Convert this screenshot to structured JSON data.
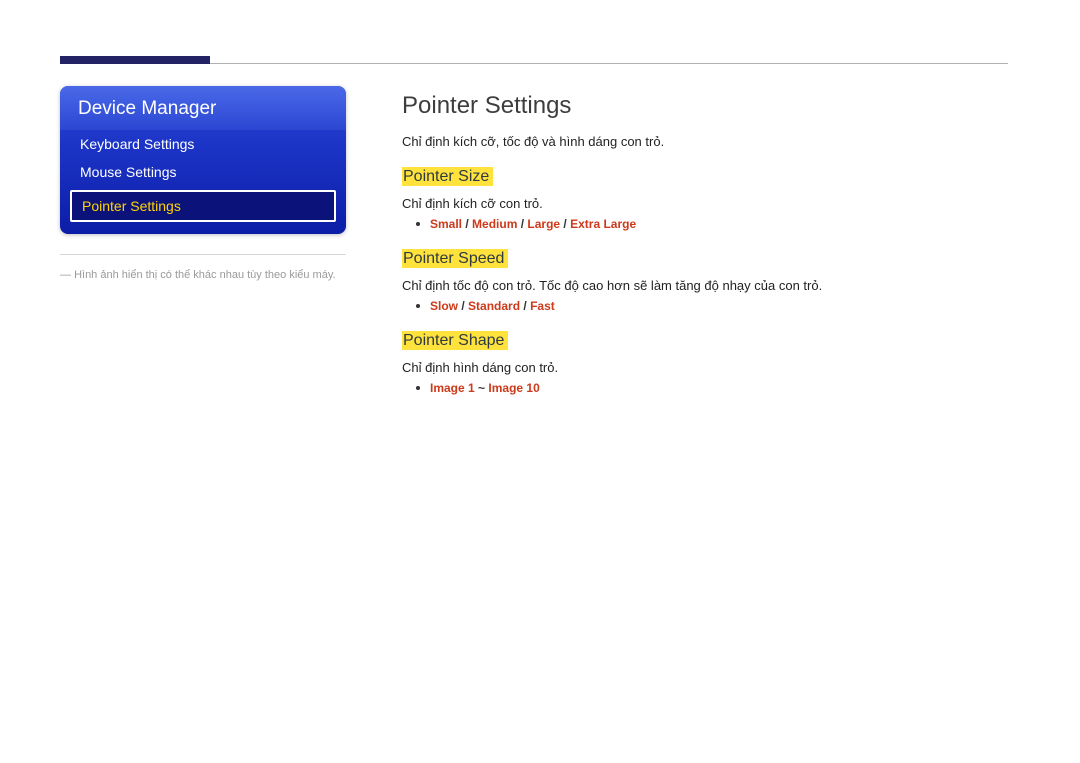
{
  "sidebar": {
    "title": "Device Manager",
    "items": [
      {
        "label": "Keyboard Settings"
      },
      {
        "label": "Mouse Settings"
      },
      {
        "label": "Pointer Settings"
      }
    ],
    "footnote_prefix": "― ",
    "footnote": "Hình ảnh hiển thị có thể khác nhau tùy theo kiểu máy."
  },
  "main": {
    "title": "Pointer Settings",
    "intro": "Chỉ định kích cỡ, tốc độ và hình dáng con trỏ.",
    "sections": [
      {
        "heading": "Pointer Size",
        "desc": "Chỉ định kích cỡ con trỏ.",
        "options": [
          "Small",
          "Medium",
          "Large",
          "Extra Large"
        ],
        "sep": " / "
      },
      {
        "heading": "Pointer Speed",
        "desc": "Chỉ định tốc độ con trỏ. Tốc độ cao hơn sẽ làm tăng độ nhạy của con trỏ.",
        "options": [
          "Slow",
          "Standard",
          "Fast"
        ],
        "sep": " / "
      },
      {
        "heading": "Pointer Shape",
        "desc": "Chỉ định hình dáng con trỏ.",
        "options": [
          "Image 1",
          "Image 10"
        ],
        "sep": " ~ "
      }
    ]
  }
}
